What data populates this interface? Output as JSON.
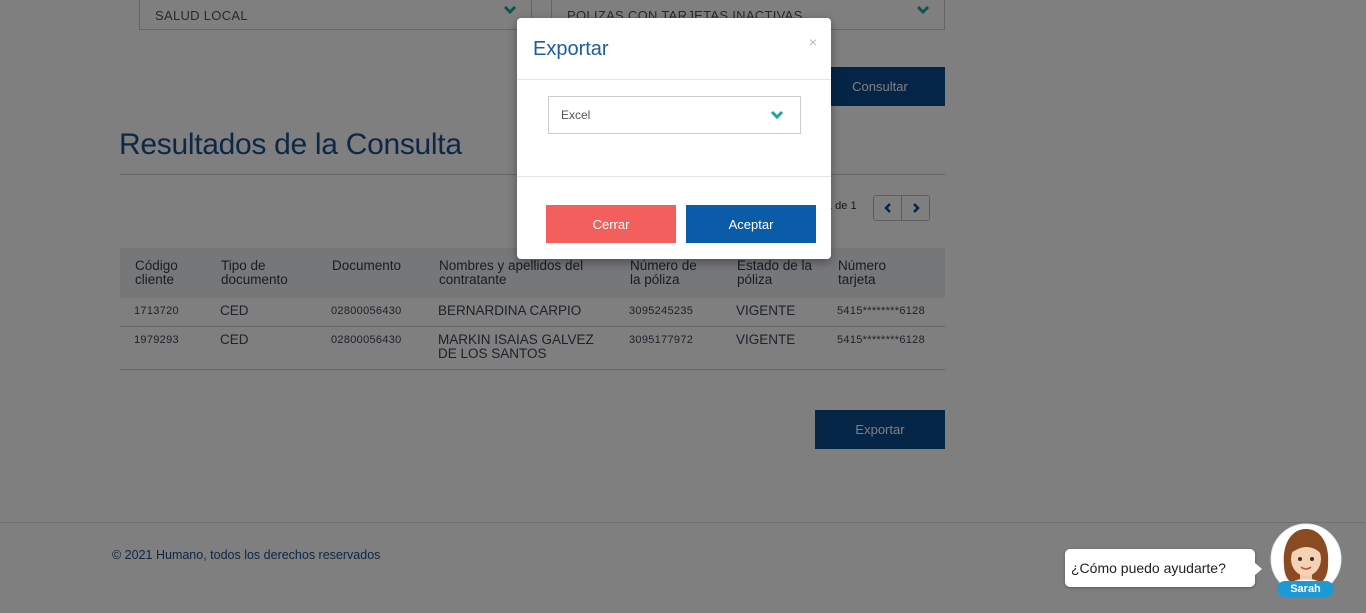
{
  "filters": {
    "product": "SALUD LOCAL",
    "report": "POLIZAS CON TARJETAS INACTIVAS"
  },
  "buttons": {
    "consultar": "Consultar",
    "exportar": "Exportar"
  },
  "results": {
    "title": "Resultados de la Consulta",
    "pagination_text": "1 de 1"
  },
  "table": {
    "headers": [
      "Código cliente",
      "Tipo de documento",
      "Documento",
      "Nombres y apellidos del contratante",
      "Número de la póliza",
      "Estado de la póliza",
      "Número tarjeta"
    ],
    "rows": [
      [
        "1713720",
        "CED",
        "02800056430",
        "BERNARDINA CARPIO",
        "3095245235",
        "VIGENTE",
        "5415********6128"
      ],
      [
        "1979293",
        "CED",
        "02800056430",
        "MARKIN ISAIAS GALVEZ DE LOS SANTOS",
        "3095177972",
        "VIGENTE",
        "5415********6128"
      ]
    ]
  },
  "footer": {
    "copyright": "© 2021 Humano, todos los derechos reservados"
  },
  "modal": {
    "title": "Exportar",
    "close_symbol": "×",
    "format_selected": "Excel",
    "cancel_label": "Cerrar",
    "accept_label": "Aceptar"
  },
  "chat": {
    "prompt": "¿Cómo puedo ayudarte?",
    "assistant_name": "Sarah"
  },
  "colors": {
    "primary": "#0a4a8f",
    "danger": "#f25f5c",
    "accent_teal": "#1aa99a"
  },
  "icons": {
    "dropdown": "chevron-down-icon",
    "prev": "chevron-left-icon",
    "next": "chevron-right-icon",
    "close": "close-icon"
  }
}
